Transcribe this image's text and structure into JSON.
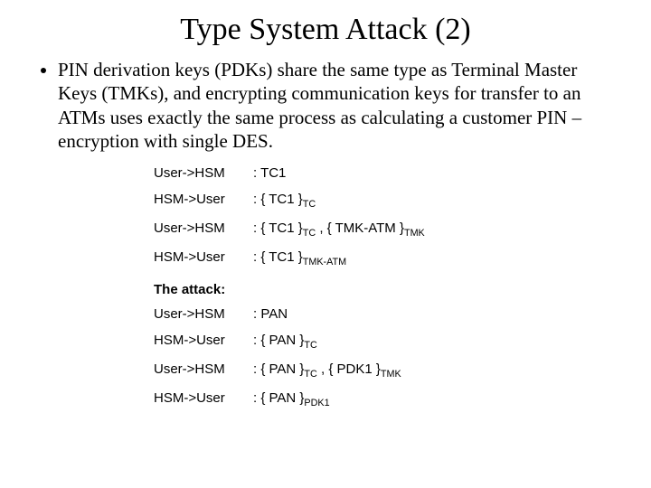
{
  "title": "Type System Attack (2)",
  "bullet": "PIN derivation keys (PDKs) share the same type as Terminal Master Keys (TMKs), and encrypting communication keys for transfer to an ATMs uses exactly the same process as calculating a customer PIN – encryption with single DES.",
  "protocol": {
    "rows": [
      {
        "dir": "User->HSM",
        "lead": ": TC1",
        "parts": []
      },
      {
        "dir": "HSM->User",
        "lead": ": { TC1 }",
        "parts": [
          {
            "sub": "TC"
          }
        ]
      },
      {
        "dir": "User->HSM",
        "lead": ": { TC1 }",
        "parts": [
          {
            "sub": "TC"
          },
          {
            "text": " , { TMK-ATM }"
          },
          {
            "sub": "TMK"
          }
        ]
      },
      {
        "dir": "HSM->User",
        "lead": ": { TC1 }",
        "parts": [
          {
            "sub": "TMK-ATM"
          }
        ]
      }
    ]
  },
  "attack": {
    "header": "The attack:",
    "rows": [
      {
        "dir": "User->HSM",
        "lead": ": PAN",
        "parts": []
      },
      {
        "dir": "HSM->User",
        "lead": ": { PAN }",
        "parts": [
          {
            "sub": "TC"
          }
        ]
      },
      {
        "dir": "User->HSM",
        "lead": ": { PAN }",
        "parts": [
          {
            "sub": "TC"
          },
          {
            "text": " , { PDK1 }"
          },
          {
            "sub": "TMK"
          }
        ]
      },
      {
        "dir": "HSM->User",
        "lead": ": { PAN }",
        "parts": [
          {
            "sub": "PDK1"
          }
        ]
      }
    ]
  }
}
